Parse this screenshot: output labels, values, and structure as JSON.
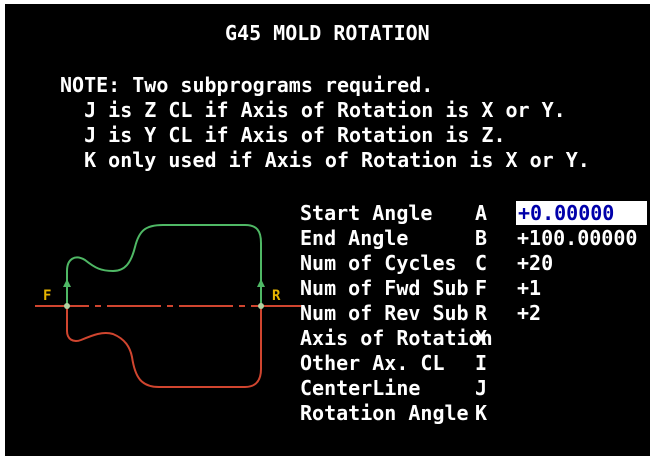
{
  "title": "G45 MOLD ROTATION",
  "note": [
    "NOTE: Two subprograms required.",
    "  J is Z CL if Axis of Rotation is X or Y.",
    "  J is Y CL if Axis of Rotation is Z.",
    "  K only used if Axis of Rotation is X or Y."
  ],
  "fields": [
    {
      "label": "Start Angle",
      "key": "A",
      "value": "+0.00000"
    },
    {
      "label": "End Angle",
      "key": "B",
      "value": "+100.00000"
    },
    {
      "label": "Num of Cycles",
      "key": "C",
      "value": "+20"
    },
    {
      "label": "Num of Fwd Sub",
      "key": "F",
      "value": "+1"
    },
    {
      "label": "Num of Rev Sub",
      "key": "R",
      "value": "+2"
    },
    {
      "label": "Axis of Rotation",
      "key": "X",
      "value": ""
    },
    {
      "label": "Other Ax. CL",
      "key": "I",
      "value": ""
    },
    {
      "label": "CenterLine",
      "key": "J",
      "value": ""
    },
    {
      "label": "Rotation Angle",
      "key": "K",
      "value": ""
    }
  ],
  "diagram": {
    "left_label": "F",
    "right_label": "R"
  },
  "colors": {
    "background": "#000000",
    "text": "#ffffff",
    "forward_path": "#4fb865",
    "reverse_path": "#d0452f",
    "centerline": "#d0452f",
    "marker": "#b0d0a0",
    "axis_labels": "#e6b400"
  }
}
